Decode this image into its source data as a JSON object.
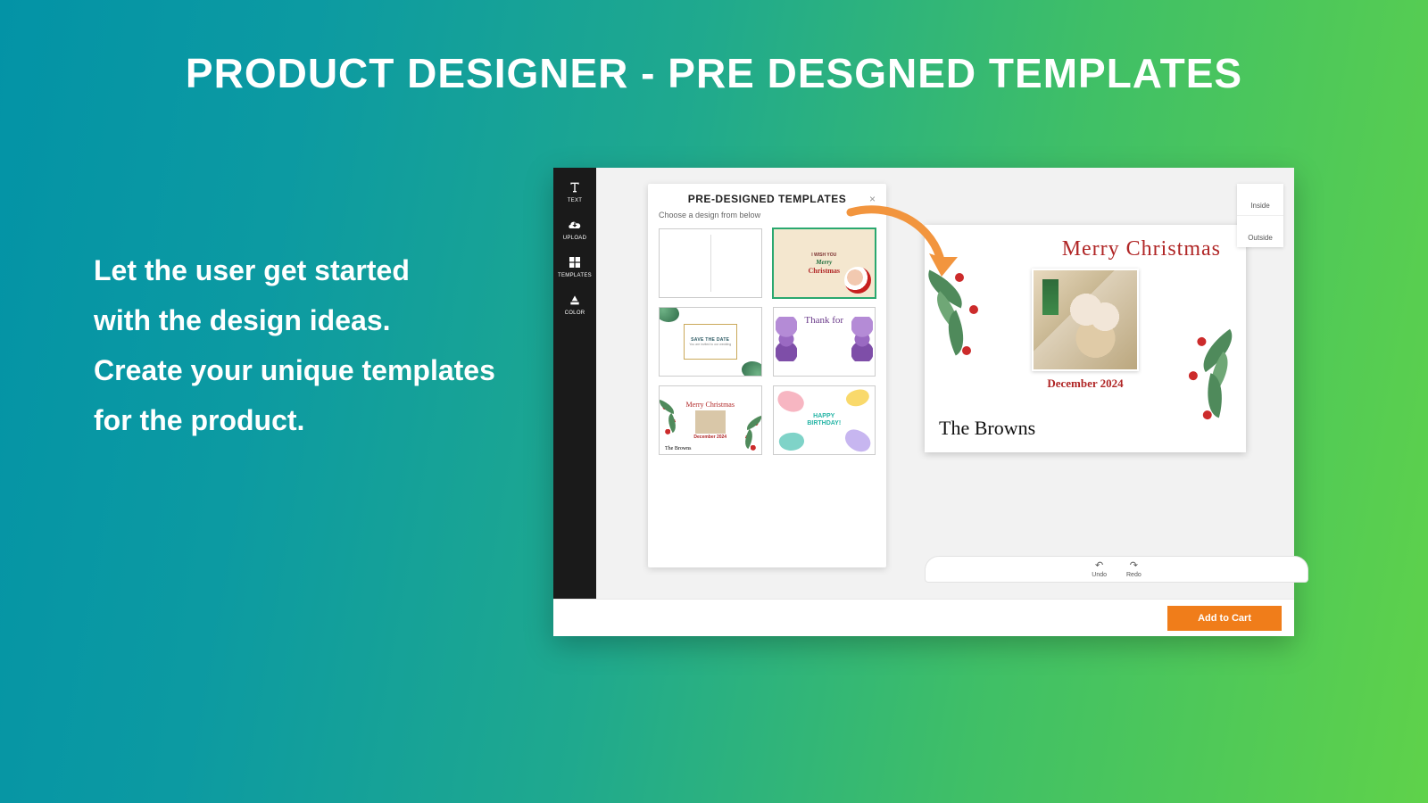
{
  "hero": {
    "title": "PRODUCT DESIGNER - PRE DESGNED TEMPLATES",
    "copy_line1": "Let the user get started",
    "copy_line2": "with the design ideas.",
    "copy_line3": "Create your unique templates",
    "copy_line4": "for the product."
  },
  "sidebar": {
    "items": [
      {
        "label": "TEXT"
      },
      {
        "label": "UPLOAD"
      },
      {
        "label": "TEMPLATES"
      },
      {
        "label": "COLOR"
      }
    ]
  },
  "templates_panel": {
    "title": "PRE-DESIGNED TEMPLATES",
    "close": "×",
    "subtitle": "Choose a design from below",
    "thumbs": {
      "t2_line1": "I WISH YOU",
      "t2_line2": "Merry",
      "t2_line3": "Christmas",
      "t3_line1": "SAVE THE DATE",
      "t3_line2": "You are invited to our wedding",
      "t4_line1": "Thank for",
      "t5_mc": "Merry Christmas",
      "t5_dec": "December 2024",
      "t5_sign": "The Browns",
      "t6_line1": "HAPPY",
      "t6_line2": "BIRTHDAY!"
    }
  },
  "canvas": {
    "merry": "Merry Christmas",
    "december": "December 2024",
    "signature": "The Browns"
  },
  "view_tabs": {
    "inside": "Inside",
    "outside": "Outside"
  },
  "undo_redo": {
    "undo": "Undo",
    "redo": "Redo"
  },
  "footer": {
    "add_to_cart": "Add to Cart"
  }
}
